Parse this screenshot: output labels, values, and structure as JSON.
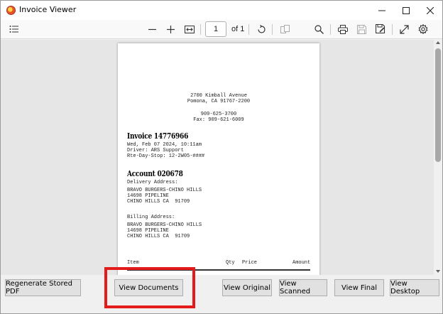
{
  "window": {
    "title": "Invoice Viewer",
    "icon": "app-icon",
    "controls": [
      "minimize-icon",
      "maximize-icon",
      "close-icon"
    ]
  },
  "toolbar": {
    "page_number": "1",
    "page_of": "of 1",
    "icons": [
      "toc-icon",
      "zoom-out-icon",
      "zoom-in-icon",
      "fit-width-icon",
      "rotate-icon",
      "two-page-icon",
      "search-icon",
      "print-icon",
      "save-icon",
      "save-as-icon",
      "expand-icon",
      "settings-icon"
    ]
  },
  "document": {
    "address_line1": "2700 Kimball Avenue",
    "address_line2": "Pomona, CA 91767-2200",
    "phone": "909-625-3700",
    "fax": "Fax: 909-621-6009",
    "invoice_title": "Invoice 14776966",
    "invoice_date": "Wed, Feb 07 2024, 10:11am",
    "driver": "Driver: ARS Support",
    "route": "Rte-Day-Stop: 12-2W05-####",
    "account_title": "Account 020678",
    "delivery_label": "Delivery Address:",
    "delivery_name": "BRAVO BURGERS-CHINO HILLS",
    "delivery_street": "14698 PIPELINE",
    "delivery_city": "CHINO HILLS CA  91709",
    "billing_label": "Billing Address:",
    "billing_name": "BRAVO BURGERS-CHINO HILLS",
    "billing_street": "14698 PIPELINE",
    "billing_city": "CHINO HILLS CA  91709",
    "table_headers": {
      "item": "Item",
      "qty": "Qty",
      "price": "Price",
      "amount": "Amount"
    }
  },
  "buttons": {
    "regenerate": "Regenerate Stored PDF",
    "view_documents": "View Documents",
    "view_original": "View Original",
    "view_scanned": "View Scanned",
    "view_final": "View Final",
    "view_desktop": "View Desktop"
  },
  "colors": {
    "highlight": "#e31b1b"
  }
}
